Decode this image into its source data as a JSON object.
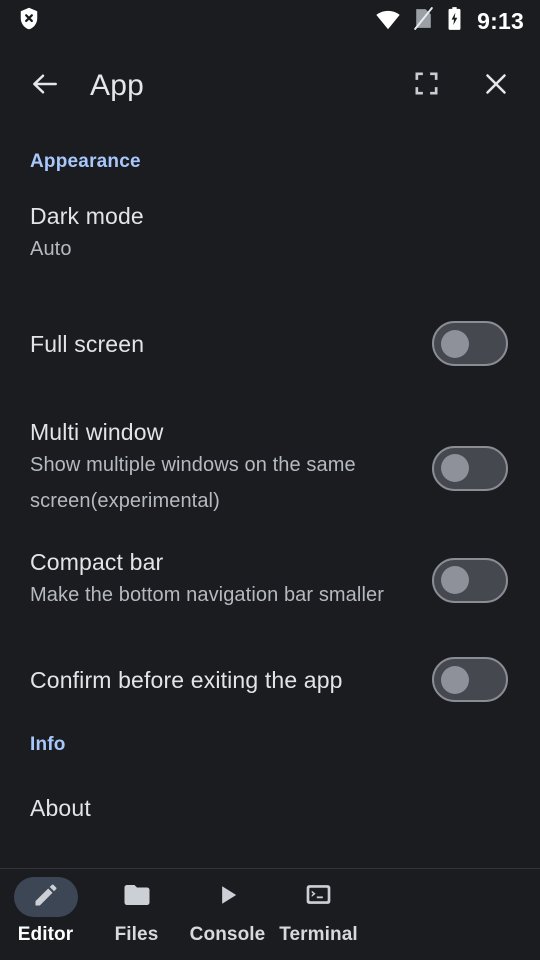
{
  "statusbar": {
    "time": "9:13",
    "icons": [
      {
        "name": "shield-x-icon"
      },
      {
        "name": "wifi-icon"
      },
      {
        "name": "sim-off-icon"
      },
      {
        "name": "battery-charging-icon"
      }
    ]
  },
  "header": {
    "title": "App",
    "back_icon": "arrow-left-icon",
    "fullscreen_icon": "fullscreen-icon",
    "close_icon": "close-icon"
  },
  "sections": {
    "appearance": {
      "label": "Appearance",
      "dark_mode": {
        "title": "Dark mode",
        "value": "Auto"
      },
      "full_screen": {
        "title": "Full screen",
        "state": "off"
      },
      "multi_window": {
        "title": "Multi window",
        "subtitle": "Show multiple windows on the same screen(experimental)",
        "state": "off"
      },
      "compact_bar": {
        "title": "Compact bar",
        "subtitle": "Make the bottom navigation bar smaller",
        "state": "off"
      },
      "confirm_exit": {
        "title": "Confirm before exiting the app",
        "state": "off"
      }
    },
    "info": {
      "label": "Info",
      "about": {
        "title": "About"
      }
    }
  },
  "bottom_nav": {
    "items": [
      {
        "label": "Editor",
        "icon": "pencil-icon",
        "active": true
      },
      {
        "label": "Files",
        "icon": "folder-icon",
        "active": false
      },
      {
        "label": "Console",
        "icon": "play-icon",
        "active": false
      },
      {
        "label": "Terminal",
        "icon": "terminal-icon",
        "active": false
      }
    ]
  },
  "colors": {
    "background": "#1a1c20",
    "accent": "#a8c7fa",
    "text_primary": "#e2e4e8",
    "text_secondary": "#b5b9c0",
    "toggle_track": "#45484f",
    "toggle_thumb": "#8e9199",
    "nav_pill": "#3d4654"
  }
}
